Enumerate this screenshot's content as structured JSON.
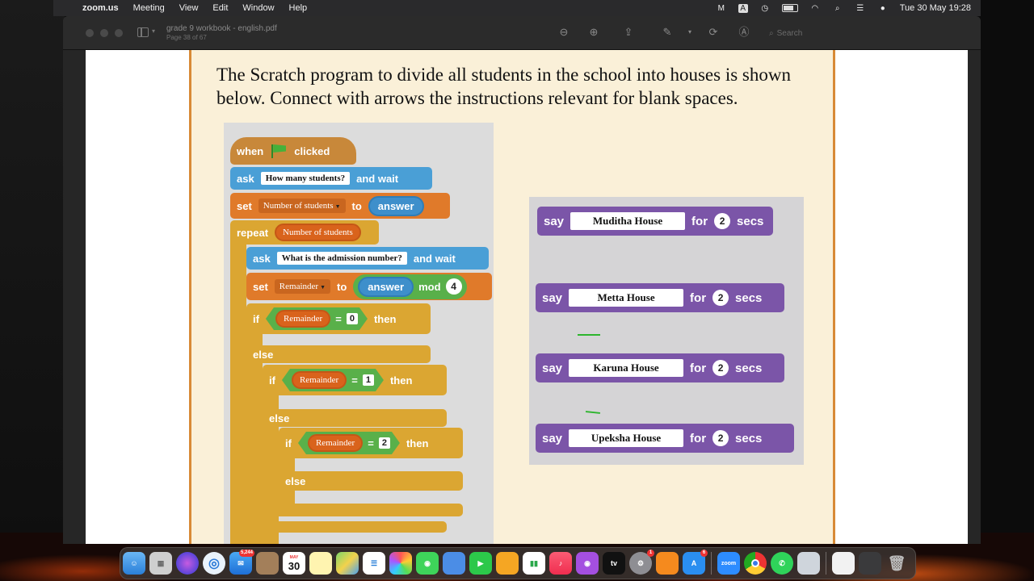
{
  "menubar": {
    "app_name": "zoom.us",
    "items": [
      "Meeting",
      "View",
      "Edit",
      "Window",
      "Help"
    ],
    "clock": "Tue 30 May  19:28"
  },
  "window": {
    "title": "grade 9 workbook - english.pdf",
    "page_info": "Page 38 of 67",
    "search_placeholder": "Search"
  },
  "document": {
    "instruction": "The Scratch program to divide all students in the school into houses is shown below. Connect with arrows the instructions relevant for blank spaces.",
    "program": {
      "when_label": "when",
      "clicked_label": "clicked",
      "ask1": {
        "ask": "ask",
        "text": "How many students?",
        "wait": "and wait"
      },
      "set1": {
        "set": "set",
        "var": "Number of students",
        "to": "to",
        "value": "answer"
      },
      "repeat": {
        "label": "repeat",
        "var": "Number of students"
      },
      "ask2": {
        "ask": "ask",
        "text": "What is the admission number?",
        "wait": "and wait"
      },
      "set2": {
        "set": "set",
        "var": "Remainder",
        "to": "to",
        "value": "answer",
        "op": "mod",
        "num": "4"
      },
      "if1": {
        "if": "if",
        "var": "Remainder",
        "eq": "=",
        "num": "0",
        "then": "then"
      },
      "else1": "else",
      "if2": {
        "if": "if",
        "var": "Remainder",
        "eq": "=",
        "num": "1",
        "then": "then"
      },
      "else2": "else",
      "if3": {
        "if": "if",
        "var": "Remainder",
        "eq": "=",
        "num": "2",
        "then": "then"
      },
      "else3": "else"
    },
    "say_blocks": [
      {
        "say": "say",
        "text": "Muditha House",
        "for": "for",
        "secs_num": "2",
        "secs": "secs"
      },
      {
        "say": "say",
        "text": "Metta House",
        "for": "for",
        "secs_num": "2",
        "secs": "secs"
      },
      {
        "say": "say",
        "text": "Karuna House",
        "for": "for",
        "secs_num": "2",
        "secs": "secs"
      },
      {
        "say": "say",
        "text": "Upeksha House",
        "for": "for",
        "secs_num": "2",
        "secs": "secs"
      }
    ]
  },
  "dock": {
    "mail_badge": "5,244",
    "calendar_month": "MAY",
    "calendar_day": "30",
    "settings_badge": "1",
    "appstore_badge": "6",
    "zoom_label": "zoom",
    "tv_label": "tv"
  },
  "colors": {
    "sheet_border": "#d88a36",
    "sheet_bg": "#faf0d8",
    "looks": "#7b55a8",
    "control": "#dba632",
    "sensing": "#4a9fd6",
    "variables": "#e07a2a",
    "operators": "#59b04a"
  }
}
